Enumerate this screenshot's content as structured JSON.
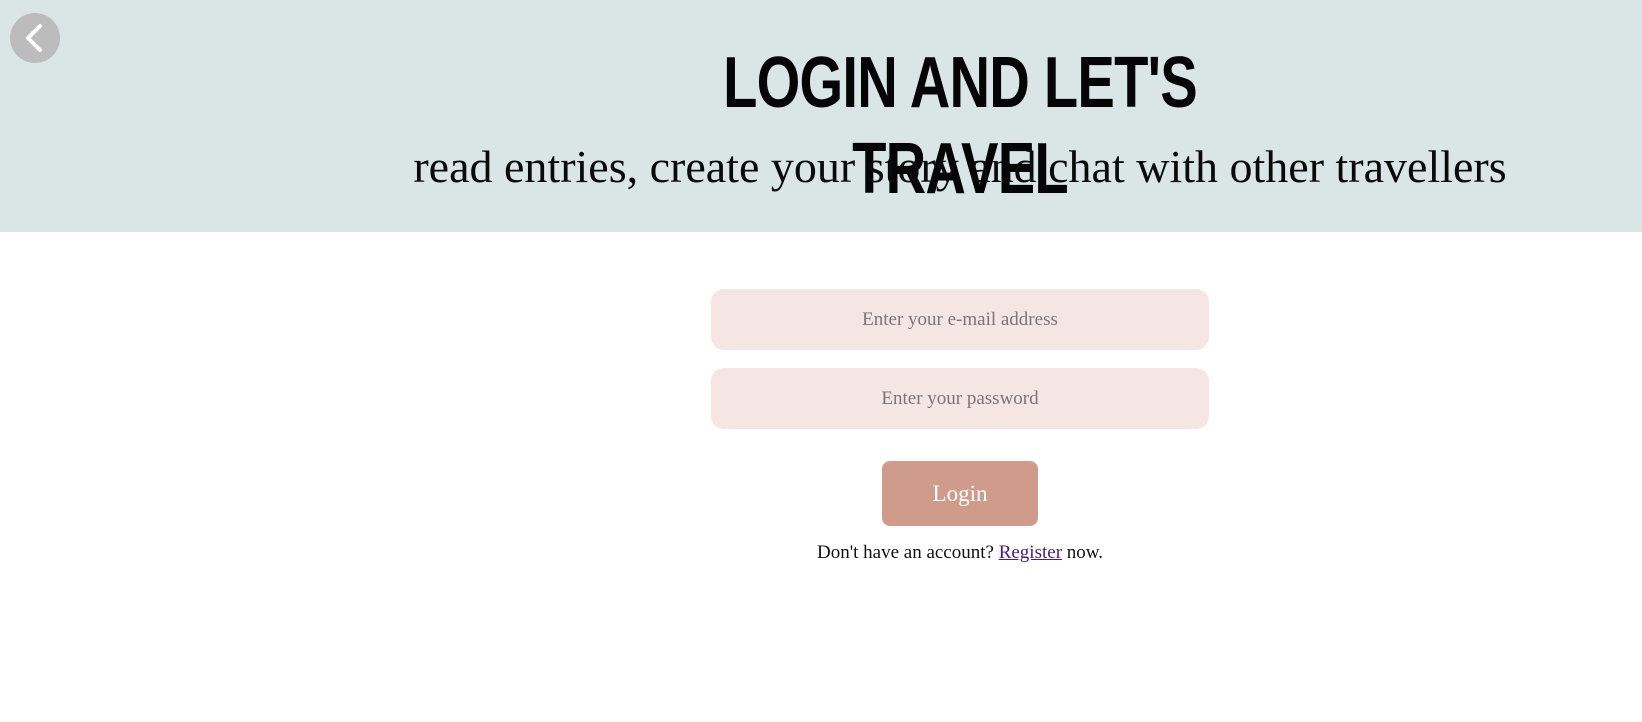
{
  "header": {
    "title": "LOGIN AND LET'S TRAVEL",
    "subtitle": "read entries, create your story and chat with other travellers",
    "back_icon": "chevron-left-icon"
  },
  "form": {
    "email_placeholder": "Enter your e-mail address",
    "email_value": "",
    "password_placeholder": "Enter your password",
    "password_value": "",
    "login_label": "Login",
    "register_prefix": "Don't have an account?",
    "register_link": "Register",
    "register_suffix": "now."
  },
  "colors": {
    "header_bg": "#dae5e5",
    "input_bg": "#f5e6e4",
    "button_bg": "#cf9c8b",
    "link": "#4b1a7d",
    "back_button_bg": "#bcbcbc"
  }
}
